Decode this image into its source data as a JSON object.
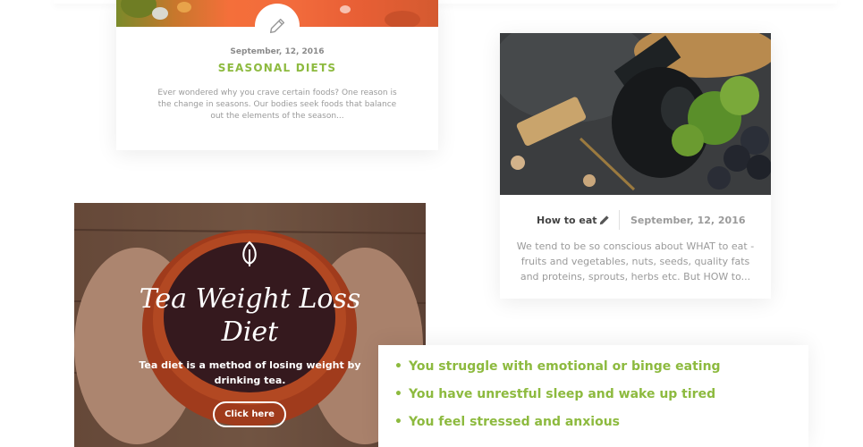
{
  "card_seasonal": {
    "date": "September, 12, 2016",
    "title": "SEASONAL DIETS",
    "excerpt": "Ever wondered why you crave certain foods? One reason is the change in seasons. Our bodies seek foods that balance out the elements of the season...",
    "icon": "pencil-icon"
  },
  "card_how_to_eat": {
    "author": "How to eat",
    "date": "September, 12, 2016",
    "excerpt": "We tend to be so conscious about WHAT to eat - fruits and vegetables, nuts, seeds, quality fats and proteins, sprouts, herbs etc. But HOW to...",
    "icon": "pencil-icon"
  },
  "promo": {
    "title_line1": "Tea Weight Loss",
    "title_line2": "Diet",
    "text": "Tea diet is a method of losing weight by drinking tea.",
    "button_label": "Click here",
    "icon": "leaf-icon"
  },
  "symptoms": {
    "items": [
      "You struggle with emotional or binge eating",
      "You have unrestful sleep and wake up tired",
      "You feel stressed and anxious"
    ],
    "bullet_color": "#8dba3f"
  },
  "colors": {
    "accent": "#8dba3f",
    "muted_text": "#9a9a9a"
  }
}
